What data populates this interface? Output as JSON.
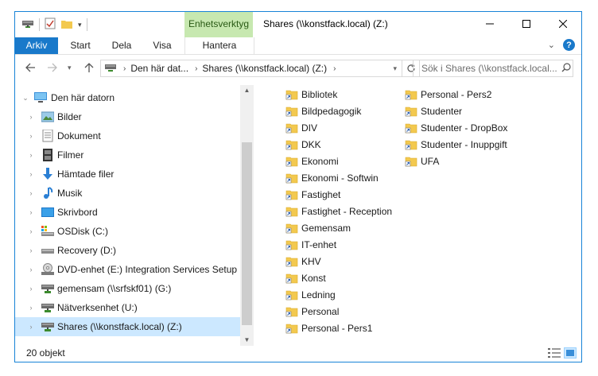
{
  "window": {
    "title": "Shares (\\\\konstfack.local) (Z:)",
    "context_tab": "Enhetsverktyg"
  },
  "ribbon": {
    "tabs": [
      {
        "label": "Arkiv"
      },
      {
        "label": "Start"
      },
      {
        "label": "Dela"
      },
      {
        "label": "Visa"
      },
      {
        "label": "Hantera"
      }
    ]
  },
  "address": {
    "crumbs": [
      "Den här dat...",
      "Shares (\\\\konstfack.local) (Z:)"
    ]
  },
  "search": {
    "placeholder": "Sök i Shares (\\\\konstfack.local..."
  },
  "nav": {
    "items": [
      {
        "label": "Den här datorn",
        "icon": "computer-icon"
      },
      {
        "label": "Bilder",
        "icon": "pictures-folder-icon"
      },
      {
        "label": "Dokument",
        "icon": "documents-folder-icon"
      },
      {
        "label": "Filmer",
        "icon": "videos-folder-icon"
      },
      {
        "label": "Hämtade filer",
        "icon": "downloads-folder-icon"
      },
      {
        "label": "Musik",
        "icon": "music-folder-icon"
      },
      {
        "label": "Skrivbord",
        "icon": "desktop-folder-icon"
      },
      {
        "label": "OSDisk (C:)",
        "icon": "system-drive-icon"
      },
      {
        "label": "Recovery (D:)",
        "icon": "drive-icon"
      },
      {
        "label": "DVD-enhet (E:) Integration Services Setup",
        "icon": "dvd-drive-icon"
      },
      {
        "label": "gemensam (\\\\srfskf01) (G:)",
        "icon": "network-drive-icon"
      },
      {
        "label": "Nätverksenhet (U:)",
        "icon": "network-drive-icon"
      },
      {
        "label": "Shares (\\\\konstfack.local) (Z:)",
        "icon": "network-drive-icon",
        "selected": true
      }
    ]
  },
  "files": {
    "column1": [
      "Bibliotek",
      "Bildpedagogik",
      "DIV",
      "DKK",
      "Ekonomi",
      "Ekonomi - Softwin",
      "Fastighet",
      "Fastighet - Reception",
      "Gemensam",
      "IT-enhet",
      "KHV",
      "Konst",
      "Ledning",
      "Personal",
      "Personal - Pers1"
    ],
    "column2": [
      "Personal - Pers2",
      "Studenter",
      "Studenter - DropBox",
      "Studenter - Inuppgift",
      "UFA"
    ]
  },
  "status": {
    "count": "20 objekt"
  },
  "colors": {
    "accent": "#1979ca",
    "selection": "#cce8ff",
    "context_tab_bg": "#c7e8b0",
    "folder": "#f3c94f"
  }
}
